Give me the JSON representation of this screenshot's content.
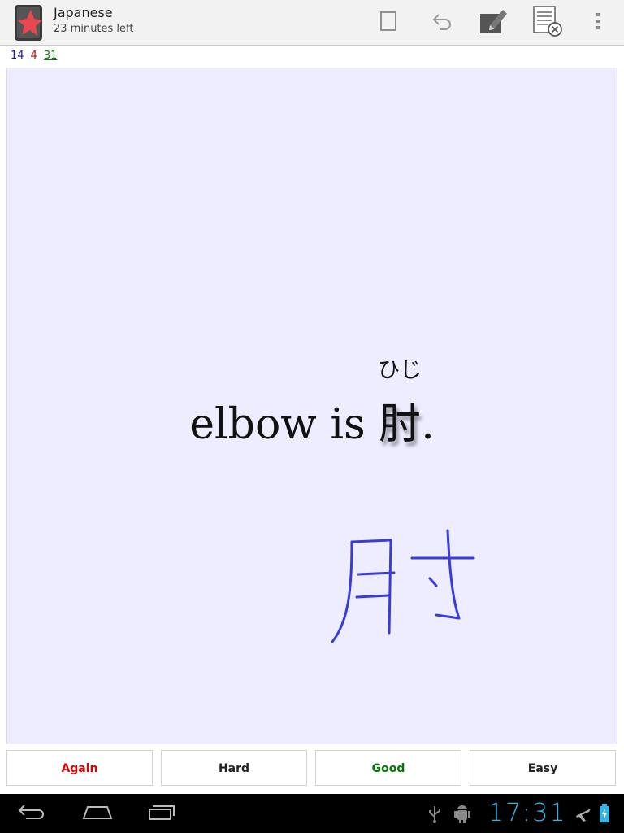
{
  "header": {
    "title": "Japanese",
    "subtitle": "23 minutes left"
  },
  "counts": {
    "new": "14",
    "learning": "4",
    "review": "31"
  },
  "card": {
    "prefix": "elbow is ",
    "kanji": "肘",
    "reading": "ひじ",
    "suffix": "."
  },
  "answers": {
    "again": "Again",
    "hard": "Hard",
    "good": "Good",
    "easy": "Easy"
  },
  "status": {
    "time": "17:31"
  },
  "colors": {
    "card_bg": "#ededff",
    "again": "#e00000",
    "good": "#007700",
    "ink": "#3b3bd8",
    "clock": "#33b5e5"
  },
  "icons": {
    "app": "anki-star-icon",
    "whiteboard": "whiteboard-icon",
    "undo": "undo-icon",
    "edit": "edit-note-icon",
    "clear": "clear-whiteboard-icon",
    "overflow": "overflow-menu-icon",
    "back": "back-icon",
    "home": "home-icon",
    "recents": "recent-apps-icon",
    "usb": "usb-icon",
    "debug": "android-debug-icon",
    "airplane": "airplane-mode-icon",
    "battery": "battery-charging-icon"
  }
}
